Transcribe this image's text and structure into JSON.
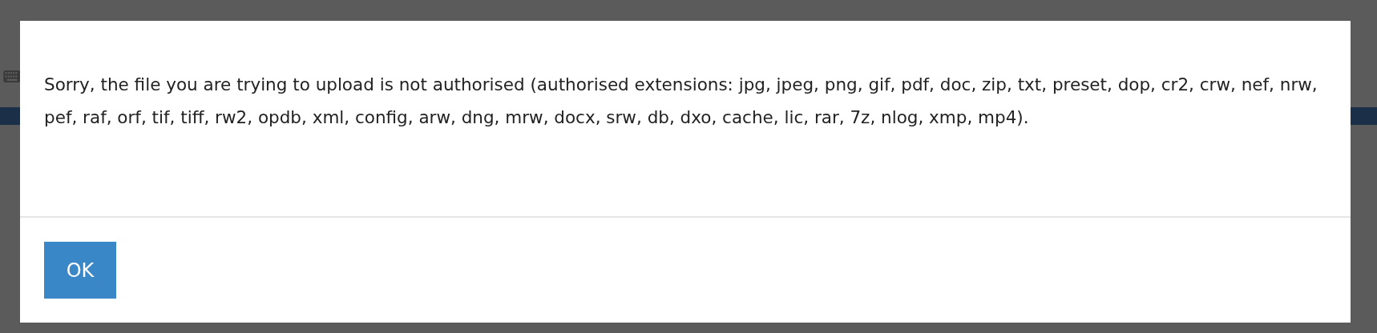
{
  "dialog": {
    "message": "Sorry, the file you are trying to upload is not authorised (authorised extensions: jpg, jpeg, png, gif, pdf, doc, zip, txt, preset, dop, cr2, crw, nef, nrw, pef, raf, orf, tif, tiff, rw2, opdb, xml, config, arw, dng, mrw, docx, srw, db, dxo, cache, lic, rar, 7z, nlog, xmp, mp4).",
    "buttons": [
      "OK"
    ]
  }
}
